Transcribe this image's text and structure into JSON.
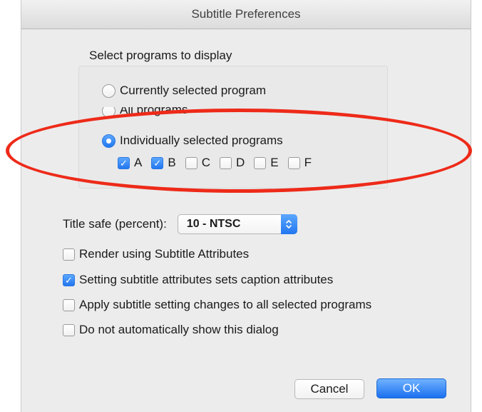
{
  "window": {
    "title": "Subtitle Preferences"
  },
  "display_group": {
    "label": "Select programs to display",
    "options": [
      {
        "label": "Currently selected program",
        "selected": false
      },
      {
        "label": "All programs",
        "selected": false
      },
      {
        "label": "Individually selected programs",
        "selected": true
      }
    ],
    "programs": [
      {
        "label": "A",
        "checked": true
      },
      {
        "label": "B",
        "checked": true
      },
      {
        "label": "C",
        "checked": false
      },
      {
        "label": "D",
        "checked": false
      },
      {
        "label": "E",
        "checked": false
      },
      {
        "label": "F",
        "checked": false
      }
    ]
  },
  "title_safe": {
    "label": "Title safe (percent):",
    "value": "10 - NTSC"
  },
  "options": [
    {
      "label": "Render using Subtitle Attributes",
      "checked": false
    },
    {
      "label": "Setting subtitle attributes sets caption attributes",
      "checked": true
    },
    {
      "label": "Apply subtitle setting changes to all selected programs",
      "checked": false
    },
    {
      "label": "Do not automatically show this dialog",
      "checked": false
    }
  ],
  "buttons": {
    "cancel": "Cancel",
    "ok": "OK"
  },
  "colors": {
    "accent": "#2277f0",
    "highlight": "#ee2a19",
    "window_bg": "#ececec"
  }
}
